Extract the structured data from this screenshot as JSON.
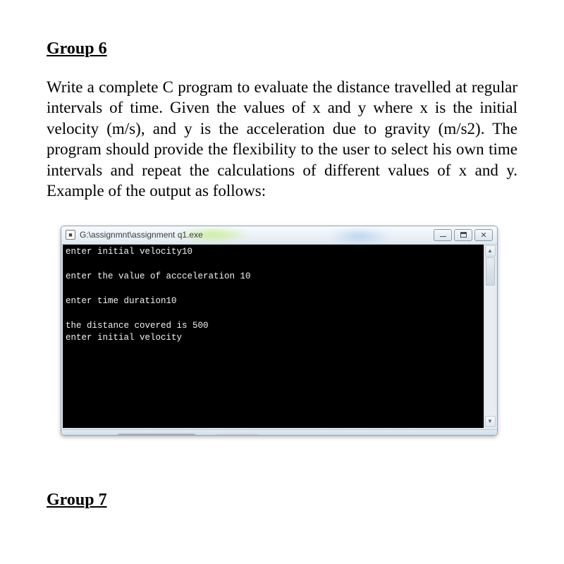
{
  "headings": {
    "group6": "Group 6",
    "group7": "Group 7"
  },
  "paragraph": "Write a complete C program to evaluate the distance travelled at regular intervals of time. Given the values of x and y where x is the initial velocity (m/s), and y is the acceleration due to gravity (m/s2). The program should provide the flexibility to the user to select his own time intervals and repeat the calculations of different values of x and y. Example of the output as follows:",
  "console": {
    "icon_label": "■",
    "title": "G:\\assignmnt\\assignment q1.exe",
    "buttons": {
      "close": "✕"
    },
    "lines": [
      "enter initial velocity10",
      "",
      "enter the value of accceleration 10",
      "",
      "enter time duration10",
      "",
      "the distance covered is 500",
      "enter initial velocity"
    ]
  }
}
